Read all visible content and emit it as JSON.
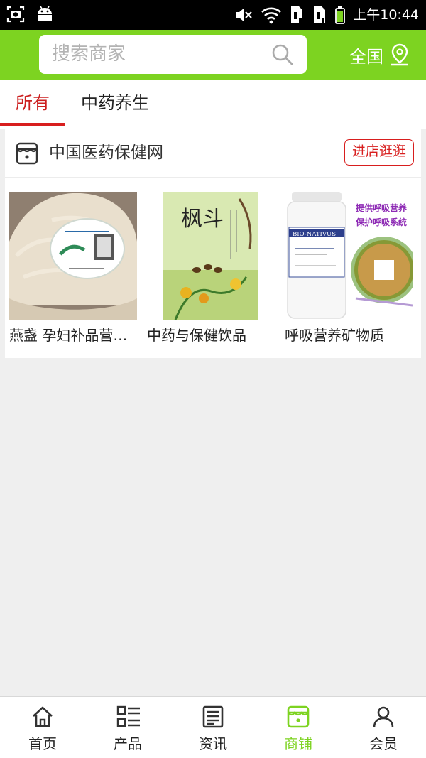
{
  "status_bar": {
    "time": "上午10:44"
  },
  "header": {
    "search_placeholder": "搜索商家",
    "region_label": "全国"
  },
  "tabs": [
    {
      "label": "所有",
      "active": true
    },
    {
      "label": "中药养生",
      "active": false
    }
  ],
  "store": {
    "name": "中国医药保健网",
    "visit_label": "进店逛逛",
    "products": [
      {
        "name": "燕盏 孕妇补品营…"
      },
      {
        "name": "中药与保健饮品",
        "book_title": "枫斗"
      },
      {
        "name": "呼吸营养矿物质",
        "badge_line1": "提供呼吸营养",
        "badge_line2": "保护呼吸系统",
        "bottle_brand": "BIO-NATIVUS"
      }
    ]
  },
  "bottom_nav": [
    {
      "label": "首页",
      "icon": "home-icon",
      "active": false
    },
    {
      "label": "产品",
      "icon": "product-list-icon",
      "active": false
    },
    {
      "label": "资讯",
      "icon": "news-icon",
      "active": false
    },
    {
      "label": "商铺",
      "icon": "store-icon",
      "active": true
    },
    {
      "label": "会员",
      "icon": "member-icon",
      "active": false
    }
  ],
  "colors": {
    "brand_green": "#7dd321",
    "accent_red": "#d81e1e"
  }
}
